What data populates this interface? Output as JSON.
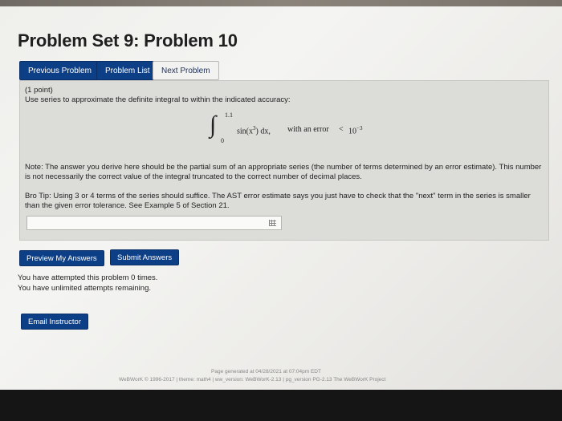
{
  "page": {
    "title": "Problem Set 9: Problem 10"
  },
  "nav": {
    "previous_label": "Previous Problem",
    "list_label": "Problem List",
    "next_label": "Next Problem"
  },
  "problem": {
    "points": "(1 point)",
    "instruction": "Use series to approximate the definite integral to within the indicated accuracy:",
    "integral": {
      "upper": "1.1",
      "lower": "0",
      "integrand": "sin(x",
      "exponent": "3",
      "integrand_tail": ") dx,",
      "with_error": "with an error",
      "less_than": "<",
      "error_base": "10",
      "error_exp": "−3"
    },
    "note_line1": "Note: The answer you derive here should be the partial sum of an appropriate series (the number of terms determined by an error estimate). This number",
    "note_line2": "is not necessarily the correct value of the integral truncated to the correct number of decimal places.",
    "tip_line1": "Bro Tip: Using 3 or 4 terms of the series should suffice. The AST error estimate says you just have to check that the \"next\" term in the series is smaller",
    "tip_line2": "than the given error tolerance. See Example 5 of Section 21.",
    "answer_value": "",
    "answer_icon": "grid-icon"
  },
  "actions": {
    "preview_label": "Preview My Answers",
    "submit_label": "Submit Answers"
  },
  "attempts": {
    "line1": "You have attempted this problem 0 times.",
    "line2": "You have unlimited attempts remaining."
  },
  "email": {
    "label": "Email Instructor"
  },
  "footer": {
    "generated": "Page generated at 04/28/2021 at 07:04pm EDT",
    "credits": "WeBWorK © 1996-2017 | theme: math4 | ww_version: WeBWorK-2.13 | pg_version PG-2.13 The WeBWorK Project"
  },
  "colors": {
    "primary_button": "#0d3f86",
    "problem_box": "#dcdcd9"
  }
}
